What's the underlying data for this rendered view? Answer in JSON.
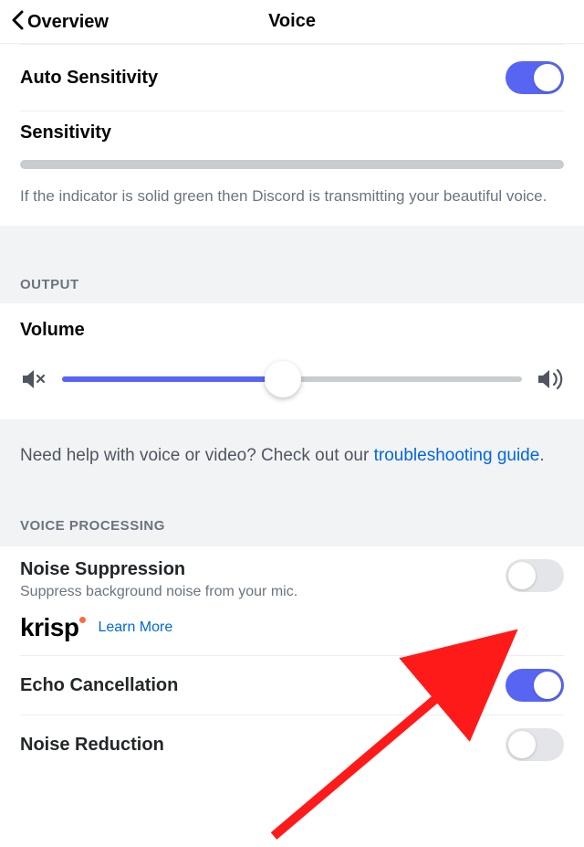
{
  "header": {
    "back_label": "Overview",
    "title": "Voice"
  },
  "auto_sensitivity": {
    "label": "Auto Sensitivity",
    "enabled": true
  },
  "sensitivity": {
    "label": "Sensitivity",
    "description": "If the indicator is solid green then Discord is transmitting your beautiful voice."
  },
  "output": {
    "section_title": "OUTPUT",
    "volume_label": "Volume",
    "volume_percent": 48
  },
  "help": {
    "text_prefix": "Need help with voice or video? Check out our ",
    "link_text": "troubleshooting guide",
    "text_suffix": "."
  },
  "voice_processing": {
    "section_title": "VOICE PROCESSING",
    "noise_suppression": {
      "title": "Noise Suppression",
      "description": "Suppress background noise from your mic.",
      "enabled": false,
      "krisp_logo_text": "krisp",
      "learn_more_label": "Learn More"
    },
    "echo_cancellation": {
      "title": "Echo Cancellation",
      "enabled": true
    },
    "noise_reduction": {
      "title": "Noise Reduction",
      "enabled": false
    }
  }
}
